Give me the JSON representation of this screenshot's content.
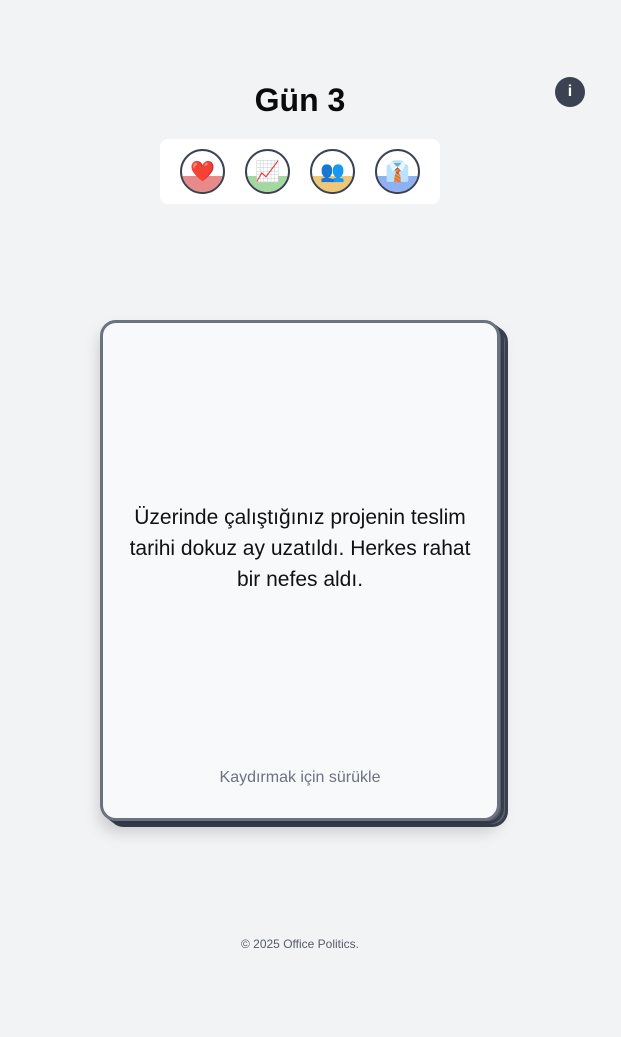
{
  "header": {
    "title": "Gün 3",
    "info_label": "i"
  },
  "stats": [
    {
      "name": "health",
      "icon": "heart-icon",
      "glyph": "❤️",
      "level": 0.4,
      "color": "#e88a8a"
    },
    {
      "name": "performance",
      "icon": "chart-increasing-icon",
      "glyph": "📈",
      "level": 0.4,
      "color": "#a5d8a0"
    },
    {
      "name": "relationships",
      "icon": "people-icon",
      "glyph": "👥",
      "level": 0.4,
      "color": "#ecc878"
    },
    {
      "name": "management",
      "icon": "business-suit-icon",
      "glyph": "👔",
      "level": 0.4,
      "color": "#8fb0f2"
    }
  ],
  "card": {
    "text": "Üzerinde çalıştığınız projenin teslim tarihi dokuz ay uzatıldı. Herkes rahat bir nefes aldı.",
    "hint": "Kaydırmak için sürükle"
  },
  "footer": {
    "copyright": "© 2025 Office Politics."
  }
}
